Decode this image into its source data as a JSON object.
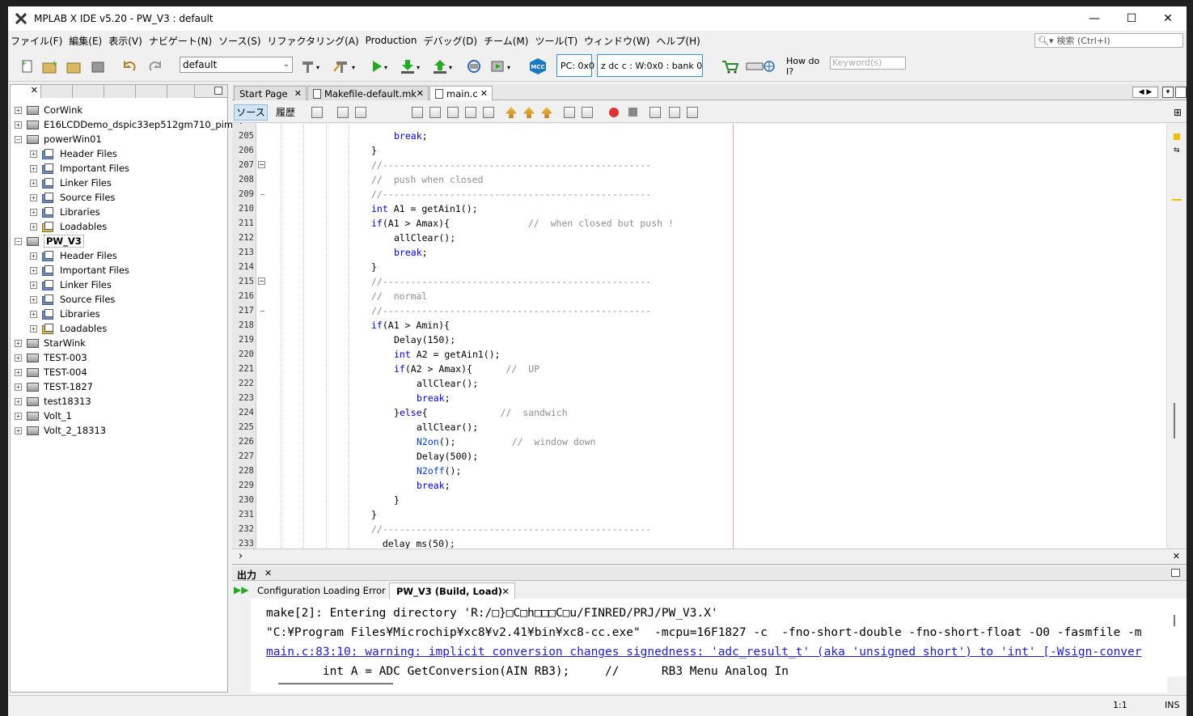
{
  "window": {
    "title": "MPLAB X IDE v5.20 - PW_V3 : default",
    "app_icon": "mplab-x-icon"
  },
  "window_controls": {
    "minimize": "—",
    "maximize": "☐",
    "close": "✕"
  },
  "menu": [
    "ファイル(F)",
    "編集(E)",
    "表示(V)",
    "ナビゲート(N)",
    "ソース(S)",
    "リファクタリング(A)",
    "Production",
    "デバッグ(D)",
    "チーム(M)",
    "ツール(T)",
    "ウィンドウ(W)",
    "ヘルプ(H)"
  ],
  "search": {
    "placeholder": "検索 (Ctrl+I)"
  },
  "toolbar": {
    "config": "default",
    "pc": "PC: 0x0",
    "status_regs": "z dc c  : W:0x0 : bank 0",
    "how_do_i": "How do I?",
    "keyword_placeholder": "Keyword(s)",
    "mcc_label": "MCC"
  },
  "projects": [
    {
      "name": "CorWink",
      "expanded": false,
      "bold": false
    },
    {
      "name": "E16LCDDemo_dspic33ep512gm710_pim_1",
      "expanded": false,
      "bold": false
    },
    {
      "name": "powerWin01",
      "expanded": true,
      "bold": false,
      "children": [
        "Header Files",
        "Important Files",
        "Linker Files",
        "Source Files",
        "Libraries",
        "Loadables"
      ]
    },
    {
      "name": "PW_V3",
      "expanded": true,
      "bold": true,
      "children": [
        "Header Files",
        "Important Files",
        "Linker Files",
        "Source Files",
        "Libraries",
        "Loadables"
      ]
    },
    {
      "name": "StarWink",
      "expanded": false,
      "bold": false
    },
    {
      "name": "TEST-003",
      "expanded": false,
      "bold": false
    },
    {
      "name": "TEST-004",
      "expanded": false,
      "bold": false
    },
    {
      "name": "TEST-1827",
      "expanded": false,
      "bold": false
    },
    {
      "name": "test18313",
      "expanded": false,
      "bold": false
    },
    {
      "name": "Volt_1",
      "expanded": false,
      "bold": false
    },
    {
      "name": "Volt_2_18313",
      "expanded": false,
      "bold": false
    }
  ],
  "editor_tabs": [
    {
      "label": "Start Page",
      "active": false
    },
    {
      "label": "Makefile-default.mk",
      "active": false
    },
    {
      "label": "main.c",
      "active": true
    }
  ],
  "editor_toolbar": {
    "source": "ソース",
    "history": "履歴"
  },
  "code_lines": [
    {
      "n": "205",
      "ind": 7,
      "parts": [
        [
          "k",
          "break"
        ],
        [
          "t",
          ";"
        ]
      ]
    },
    {
      "n": "206",
      "ind": 6,
      "parts": [
        [
          "t",
          "}"
        ]
      ]
    },
    {
      "n": "207",
      "ind": 6,
      "parts": [
        [
          "c",
          "//------------------------------------------------"
        ]
      ]
    },
    {
      "n": "208",
      "ind": 6,
      "parts": [
        [
          "c",
          "//  push when closed"
        ]
      ]
    },
    {
      "n": "209",
      "ind": 6,
      "parts": [
        [
          "c",
          "//------------------------------------------------"
        ]
      ]
    },
    {
      "n": "210",
      "ind": 6,
      "parts": [
        [
          "k",
          "int"
        ],
        [
          "t",
          " A1 = getAin1();"
        ]
      ]
    },
    {
      "n": "211",
      "ind": 6,
      "parts": [
        [
          "k",
          "if"
        ],
        [
          "t",
          "(A1 > Amax){              "
        ],
        [
          "c",
          "//  when closed but push !"
        ]
      ]
    },
    {
      "n": "212",
      "ind": 7,
      "parts": [
        [
          "t",
          "allClear();"
        ]
      ]
    },
    {
      "n": "213",
      "ind": 7,
      "parts": [
        [
          "k",
          "break"
        ],
        [
          "t",
          ";"
        ]
      ]
    },
    {
      "n": "214",
      "ind": 6,
      "parts": [
        [
          "t",
          "}"
        ]
      ]
    },
    {
      "n": "215",
      "ind": 6,
      "parts": [
        [
          "c",
          "//------------------------------------------------"
        ]
      ]
    },
    {
      "n": "216",
      "ind": 6,
      "parts": [
        [
          "c",
          "//  normal"
        ]
      ]
    },
    {
      "n": "217",
      "ind": 6,
      "parts": [
        [
          "c",
          "//------------------------------------------------"
        ]
      ]
    },
    {
      "n": "218",
      "ind": 6,
      "parts": [
        [
          "k",
          "if"
        ],
        [
          "t",
          "(A1 > Amin){"
        ]
      ]
    },
    {
      "n": "219",
      "ind": 7,
      "parts": [
        [
          "t",
          "Delay(150);"
        ]
      ]
    },
    {
      "n": "220",
      "ind": 7,
      "parts": [
        [
          "k",
          "int"
        ],
        [
          "t",
          " A2 = getAin1();"
        ]
      ]
    },
    {
      "n": "221",
      "ind": 7,
      "parts": [
        [
          "k",
          "if"
        ],
        [
          "t",
          "(A2 > Amax){      "
        ],
        [
          "c",
          "//  UP"
        ]
      ]
    },
    {
      "n": "222",
      "ind": 8,
      "parts": [
        [
          "t",
          "allClear();"
        ]
      ]
    },
    {
      "n": "223",
      "ind": 8,
      "parts": [
        [
          "k",
          "break"
        ],
        [
          "t",
          ";"
        ]
      ]
    },
    {
      "n": "224",
      "ind": 7,
      "parts": [
        [
          "t",
          "}"
        ],
        [
          "k",
          "else"
        ],
        [
          "t",
          "{             "
        ],
        [
          "c",
          "//  sandwich"
        ]
      ]
    },
    {
      "n": "225",
      "ind": 8,
      "parts": [
        [
          "t",
          "allClear();"
        ]
      ]
    },
    {
      "n": "226",
      "ind": 8,
      "parts": [
        [
          "f",
          "N2on"
        ],
        [
          "t",
          "();          "
        ],
        [
          "c",
          "//  window down"
        ]
      ]
    },
    {
      "n": "227",
      "ind": 8,
      "parts": [
        [
          "t",
          "Delay(500);"
        ]
      ]
    },
    {
      "n": "228",
      "ind": 8,
      "parts": [
        [
          "f",
          "N2off"
        ],
        [
          "t",
          "();"
        ]
      ]
    },
    {
      "n": "229",
      "ind": 8,
      "parts": [
        [
          "k",
          "break"
        ],
        [
          "t",
          ";"
        ]
      ]
    },
    {
      "n": "230",
      "ind": 7,
      "parts": [
        [
          "t",
          "}"
        ]
      ]
    },
    {
      "n": "231",
      "ind": 6,
      "parts": [
        [
          "t",
          "}"
        ]
      ]
    },
    {
      "n": "232",
      "ind": 6,
      "parts": [
        [
          "c",
          "//------------------------------------------------"
        ]
      ]
    },
    {
      "n": "233",
      "ind": 6,
      "parts": [
        [
          "t",
          "  delay_ms(50);"
        ]
      ]
    }
  ],
  "output": {
    "title": "出力",
    "tabs": [
      {
        "label": "Configuration Loading Error",
        "active": false
      },
      {
        "label": "PW_V3 (Build, Load)",
        "active": true
      }
    ],
    "lines": [
      {
        "text": "make[2]: Entering directory 'R:/□}□C□h□□□C□u/FINRED/PRJ/PW_V3.X'",
        "link": false
      },
      {
        "text": "\"C:¥Program Files¥Microchip¥xc8¥v2.41¥bin¥xc8-cc.exe\"  -mcpu=16F1827 -c  -fno-short-double -fno-short-float -O0 -fasmfile -m",
        "link": false
      },
      {
        "text": "main.c:83:10: warning: implicit conversion changes signedness: 'adc_result_t' (aka 'unsigned short') to 'int' [-Wsign-conver",
        "link": true
      },
      {
        "text": "        int A = ADC_GetConversion(AIN_RB3);     //      RB3 Menu Analog In",
        "link": false
      }
    ]
  },
  "statusbar": {
    "position": "1:1",
    "mode": "INS"
  },
  "colors": {
    "keyword": "#0000e0",
    "comment": "#909090",
    "function": "#0040d0",
    "accent": "#3a8fd0"
  }
}
